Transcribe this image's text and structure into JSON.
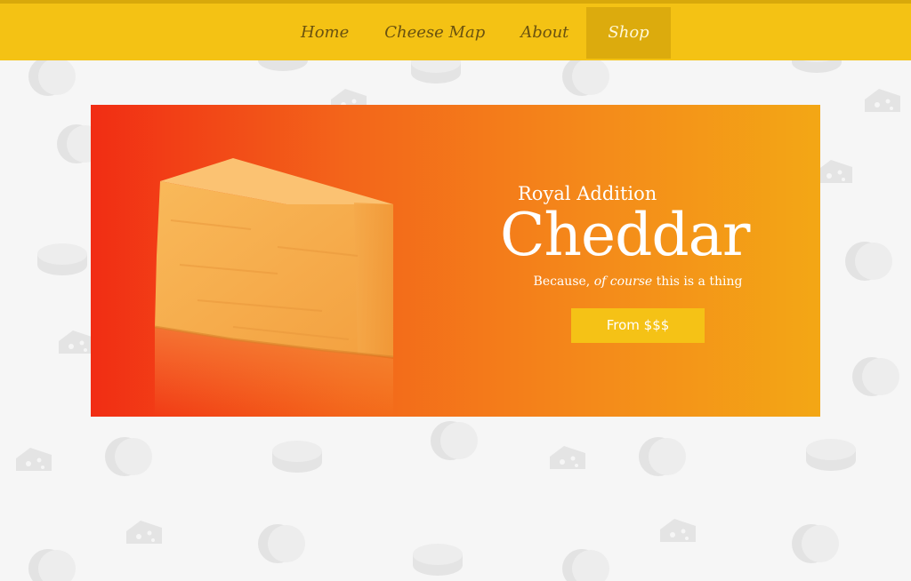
{
  "nav": {
    "items": [
      {
        "label": "Home",
        "active": false
      },
      {
        "label": "Cheese Map",
        "active": false
      },
      {
        "label": "About",
        "active": false
      },
      {
        "label": "Shop",
        "active": true
      }
    ]
  },
  "hero": {
    "subtitle": "Royal Addition",
    "title": "Cheddar",
    "tagline_prefix": "Because,",
    "tagline_emphasis": "of course",
    "tagline_suffix": "this is a thing",
    "cta_label": "From $$$"
  },
  "icons": {
    "hero_image": "cheddar-wedge-image",
    "background_pattern": [
      "cheese-wheel-icon",
      "cheese-wedge-icon"
    ]
  },
  "colors": {
    "nav_bg": "#f4c214",
    "nav_active_bg": "#dcab0d",
    "banner_gradient_start": "#f12d14",
    "banner_gradient_end": "#f3a715",
    "cta_bg": "#f5c216",
    "page_bg": "#f6f6f6"
  }
}
